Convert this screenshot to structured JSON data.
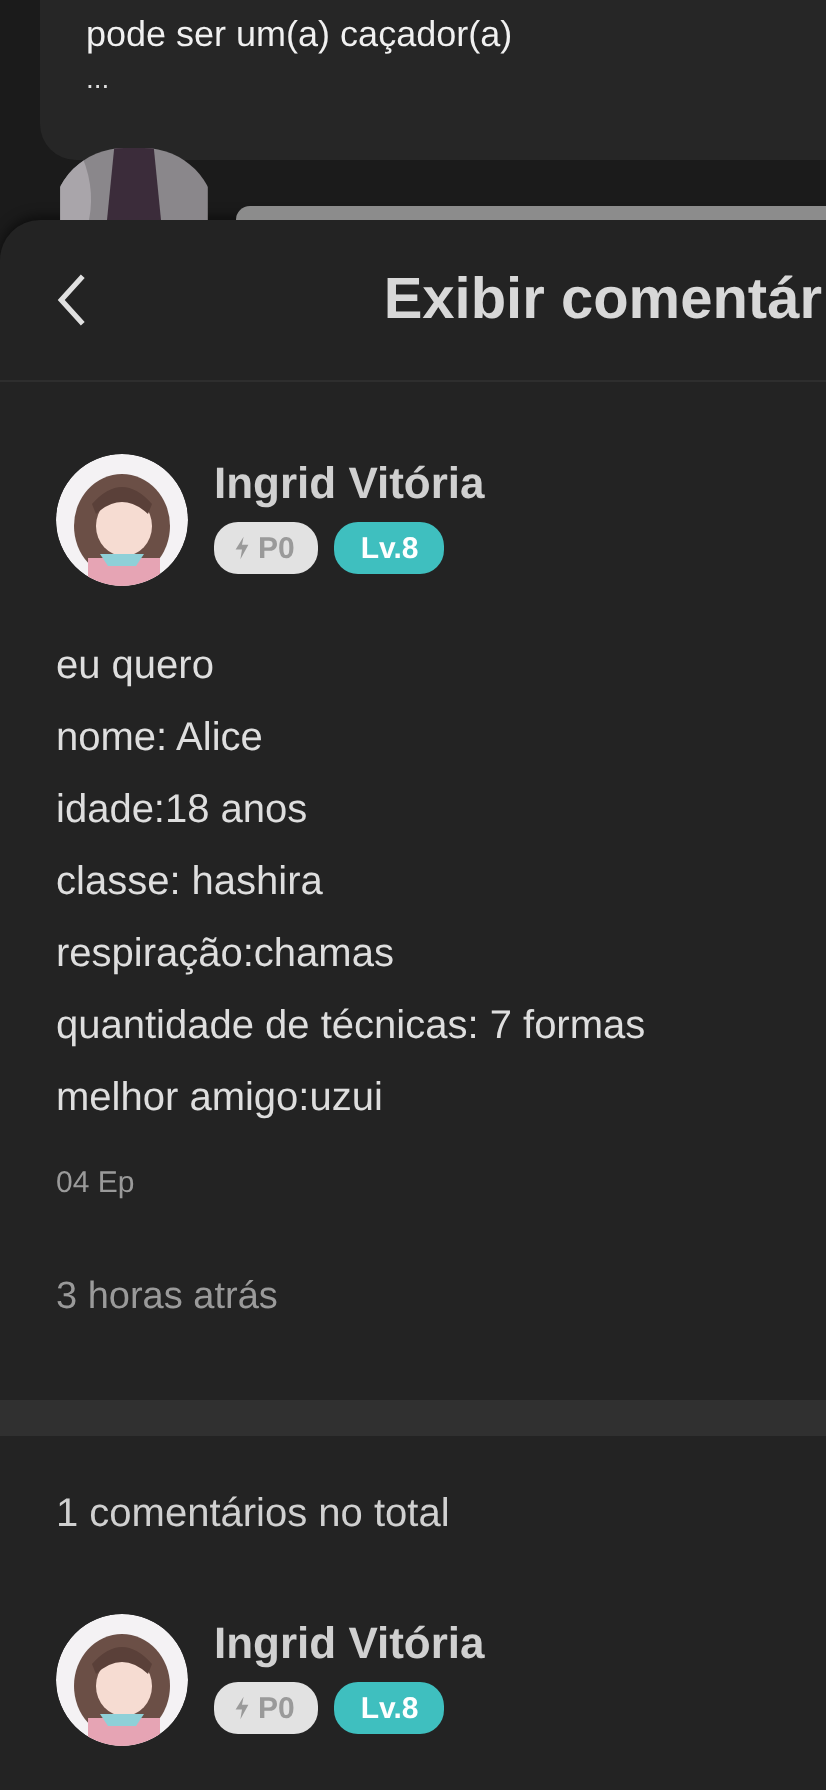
{
  "previous_comment": {
    "text": "pode ser um(a) caçador(a)",
    "more": "..."
  },
  "header": {
    "title": "Exibir comentár"
  },
  "comment": {
    "author": "Ingrid Vitória",
    "points_badge": "P0",
    "level_badge": "Lv.8",
    "lines": [
      "eu quero",
      "nome: Alice",
      "idade:18 anos",
      "classe: hashira",
      "respiração:chamas",
      "quantidade de técnicas: 7 formas",
      "melhor amigo:uzui"
    ],
    "episode": "04 Ep",
    "time": "3 horas atrás"
  },
  "replies": {
    "count_label": "1 comentários no total",
    "items": [
      {
        "author": "Ingrid Vitória",
        "points_badge": "P0",
        "level_badge": "Lv.8"
      }
    ]
  }
}
